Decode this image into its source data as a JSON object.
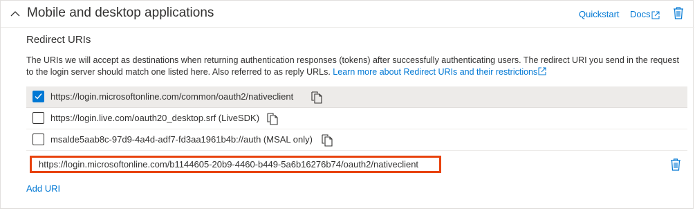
{
  "header": {
    "title": "Mobile and desktop applications",
    "quickstart_label": "Quickstart",
    "docs_label": "Docs"
  },
  "redirect": {
    "section_title": "Redirect URIs",
    "description": "The URIs we will accept as destinations when returning authentication responses (tokens) after successfully authenticating users. The redirect URI you send in the request to the login server should match one listed here. Also referred to as reply URLs.",
    "learn_more_label": "Learn more about Redirect URIs and their restrictions",
    "uris": [
      {
        "label": "https://login.microsoftonline.com/common/oauth2/nativeclient",
        "checked": true
      },
      {
        "label": "https://login.live.com/oauth20_desktop.srf (LiveSDK)",
        "checked": false
      },
      {
        "label": "msalde5aab8c-97d9-4a4d-adf7-fd3aa1961b4b://auth (MSAL only)",
        "checked": false
      }
    ],
    "custom_uri_value": "https://login.microsoftonline.com/b1144605-20b9-4460-b449-5a6b16276b74/oauth2/nativeclient",
    "add_uri_label": "Add URI"
  },
  "icons": {
    "collapse": "chevron-up-icon",
    "external": "external-link-icon",
    "delete": "trash-icon",
    "copy": "copy-icon",
    "check": "checkmark-icon"
  },
  "colors": {
    "accent": "#0078d4",
    "highlight_border": "#e8420d",
    "selected_row": "#edebe9"
  }
}
